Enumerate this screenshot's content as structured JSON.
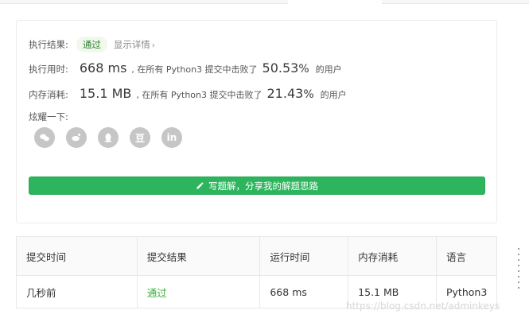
{
  "result": {
    "status_label": "执行结果:",
    "status_value": "通过",
    "details_link": "显示详情",
    "runtime": {
      "label": "执行用时:",
      "value": "668 ms",
      "text": ", 在所有 Python3 提交中击败了",
      "percent": "50.53",
      "percent_unit": "%",
      "suffix": "的用户"
    },
    "memory": {
      "label": "内存消耗:",
      "value": "15.1 MB",
      "text": ", 在所有 Python3 提交中击败了",
      "percent": "21.43",
      "percent_unit": "%",
      "suffix": "的用户"
    },
    "share_label": "炫耀一下:",
    "share_icons": [
      "wechat-icon",
      "weibo-icon",
      "qq-icon",
      "douban-icon",
      "linkedin-icon"
    ],
    "douban_glyph": "豆",
    "linkedin_glyph": "in",
    "write_button": "写题解，分享我的解题思路"
  },
  "table": {
    "headers": [
      "提交时间",
      "提交结果",
      "运行时间",
      "内存消耗",
      "语言"
    ],
    "rows": [
      [
        "几秒前",
        "通过",
        "668 ms",
        "15.1 MB",
        "Python3"
      ]
    ]
  },
  "watermark": "https://blog.csdn.net/adminkeys",
  "colors": {
    "accent_green": "#2db55d",
    "success_text": "#3daf3d",
    "icon_gray": "#c6c6c6"
  }
}
